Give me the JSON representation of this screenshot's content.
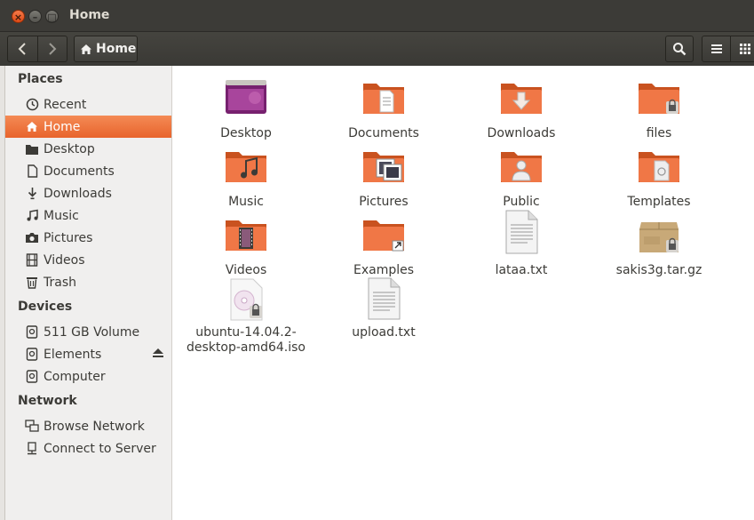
{
  "window": {
    "title": "Home"
  },
  "toolbar": {
    "crumb": "Home"
  },
  "sidebar": {
    "places_header": "Places",
    "places": [
      {
        "label": "Recent",
        "icon": "clock-icon"
      },
      {
        "label": "Home",
        "icon": "home-icon"
      },
      {
        "label": "Desktop",
        "icon": "folder-icon"
      },
      {
        "label": "Documents",
        "icon": "document-icon"
      },
      {
        "label": "Downloads",
        "icon": "download-icon"
      },
      {
        "label": "Music",
        "icon": "music-icon"
      },
      {
        "label": "Pictures",
        "icon": "camera-icon"
      },
      {
        "label": "Videos",
        "icon": "film-icon"
      },
      {
        "label": "Trash",
        "icon": "trash-icon"
      }
    ],
    "devices_header": "Devices",
    "devices": [
      {
        "label": "511 GB Volume",
        "icon": "drive-icon"
      },
      {
        "label": "Elements",
        "icon": "drive-icon"
      },
      {
        "label": "Computer",
        "icon": "drive-icon"
      }
    ],
    "network_header": "Network",
    "network": [
      {
        "label": "Browse Network",
        "icon": "network-icon"
      },
      {
        "label": "Connect to Server",
        "icon": "server-icon"
      }
    ]
  },
  "files": [
    {
      "label": "Desktop",
      "type": "desktop"
    },
    {
      "label": "Documents",
      "type": "folder-documents"
    },
    {
      "label": "Downloads",
      "type": "folder-downloads"
    },
    {
      "label": "files",
      "type": "folder-locked"
    },
    {
      "label": "Music",
      "type": "folder-music"
    },
    {
      "label": "Pictures",
      "type": "folder-pictures"
    },
    {
      "label": "Public",
      "type": "folder-public"
    },
    {
      "label": "Templates",
      "type": "folder-templates"
    },
    {
      "label": "Videos",
      "type": "folder-videos"
    },
    {
      "label": "Examples",
      "type": "folder-link"
    },
    {
      "label": "lataa.txt",
      "type": "text"
    },
    {
      "label": "sakis3g.tar.gz",
      "type": "archive"
    },
    {
      "label": "ubuntu-14.04.2-desktop-amd64.iso",
      "label_line1": "ubuntu-14.04.2-",
      "label_line2": "desktop-amd64.iso",
      "type": "disc"
    },
    {
      "label": "upload.txt",
      "type": "text"
    }
  ],
  "colors": {
    "accent": "#e95420",
    "folder": "#f07746",
    "titlebar": "#3c3b37"
  }
}
